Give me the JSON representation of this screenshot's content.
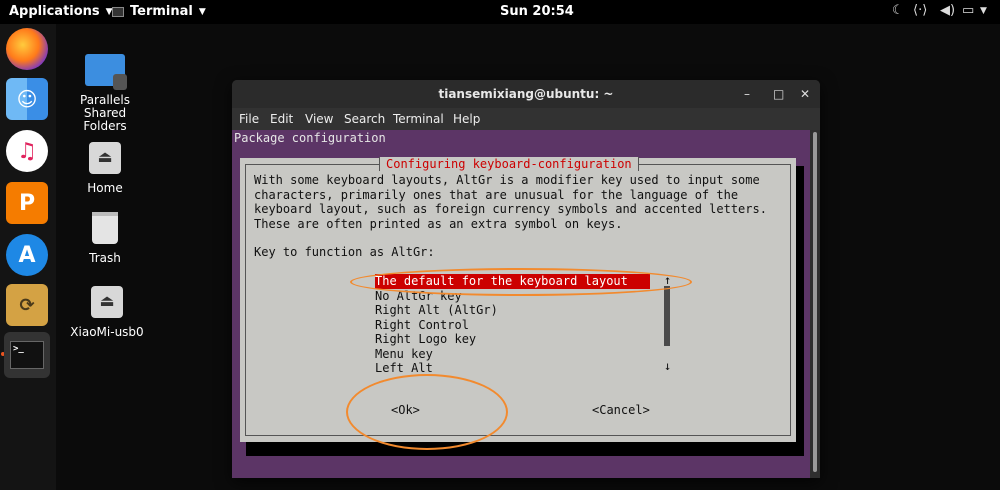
{
  "topbar": {
    "applications": "Applications",
    "terminal": "Terminal",
    "clock": "Sun 20:54"
  },
  "dock": {
    "items": [
      "firefox",
      "finder",
      "itunes",
      "pages",
      "app-store",
      "backup",
      "terminal"
    ]
  },
  "desktop": {
    "icons": [
      {
        "label": "Parallels Shared Folders"
      },
      {
        "label": "Home"
      },
      {
        "label": "Trash"
      },
      {
        "label": "XiaoMi-usb0"
      }
    ]
  },
  "window": {
    "title": "tiansemixiang@ubuntu: ~",
    "menu": [
      "File",
      "Edit",
      "View",
      "Search",
      "Terminal",
      "Help"
    ]
  },
  "terminal": {
    "package_config": "Package configuration",
    "dialog_title": "Configuring keyboard-configuration",
    "description": [
      "With some keyboard layouts, AltGr is a modifier key used to input some",
      "characters, primarily ones that are unusual for the language of the",
      "keyboard layout, such as foreign currency symbols and accented letters.",
      "These are often printed as an extra symbol on keys."
    ],
    "prompt": "Key to function as AltGr:",
    "options": [
      "The default for the keyboard layout",
      "No AltGr key",
      "Right Alt (AltGr)",
      "Right Control",
      "Right Logo key",
      "Menu key",
      "Left Alt"
    ],
    "ok": "<Ok>",
    "cancel": "<Cancel>"
  },
  "colors": {
    "terminal_bg": "#5c3566",
    "dialog_bg": "#c8c8c4",
    "selection": "#cc0000",
    "annotation": "#f28a2e"
  }
}
